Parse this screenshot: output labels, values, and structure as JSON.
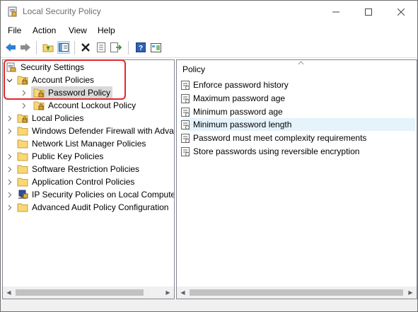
{
  "window": {
    "title": "Local Security Policy"
  },
  "titlebar_icons": {
    "minimize": "minimize-icon",
    "maximize": "maximize-icon",
    "close": "close-icon"
  },
  "menu": {
    "items": [
      "File",
      "Action",
      "View",
      "Help"
    ]
  },
  "toolbar": {
    "icons": [
      "back-arrow-icon",
      "forward-arrow-icon",
      "up-folder-icon",
      "show-hide-tree-icon",
      "delete-icon",
      "properties-icon",
      "export-list-icon",
      "help-icon",
      "view-icon"
    ]
  },
  "tree": {
    "root": "Security Settings",
    "items": [
      {
        "label": "Account Policies",
        "expanded": true
      },
      {
        "label": "Password Policy",
        "selected": true
      },
      {
        "label": "Account Lockout Policy"
      },
      {
        "label": "Local Policies"
      },
      {
        "label": "Windows Defender Firewall with Adva"
      },
      {
        "label": "Network List Manager Policies"
      },
      {
        "label": "Public Key Policies"
      },
      {
        "label": "Software Restriction Policies"
      },
      {
        "label": "Application Control Policies"
      },
      {
        "label": "IP Security Policies on Local Compute"
      },
      {
        "label": "Advanced Audit Policy Configuration"
      }
    ]
  },
  "list": {
    "header": "Policy",
    "items": [
      {
        "label": "Enforce password history"
      },
      {
        "label": "Maximum password age"
      },
      {
        "label": "Minimum password age"
      },
      {
        "label": "Minimum password length",
        "selected": true
      },
      {
        "label": "Password must meet complexity requirements"
      },
      {
        "label": "Store passwords using reversible encryption"
      }
    ]
  },
  "colors": {
    "highlight_box": "#e0282c",
    "selection": "#d9d9d9",
    "list_selection": "#e5f3fb",
    "folder": "#f8d775"
  }
}
